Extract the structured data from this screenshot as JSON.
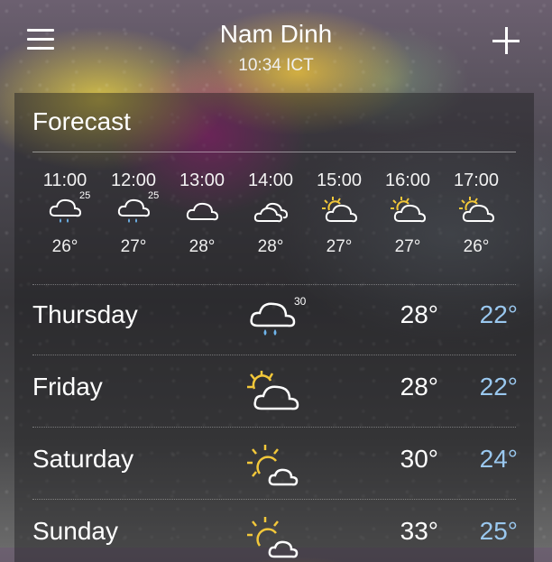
{
  "header": {
    "city": "Nam Dinh",
    "time": "10:34 ICT"
  },
  "forecast": {
    "title": "Forecast",
    "hourly": [
      {
        "time": "11:00",
        "icon": "cloud-rain-icon",
        "temp": "26°",
        "pop": "25"
      },
      {
        "time": "12:00",
        "icon": "cloud-rain-icon",
        "temp": "27°",
        "pop": "25"
      },
      {
        "time": "13:00",
        "icon": "cloud-icon",
        "temp": "28°",
        "pop": ""
      },
      {
        "time": "14:00",
        "icon": "clouds-icon",
        "temp": "28°",
        "pop": ""
      },
      {
        "time": "15:00",
        "icon": "partly-sunny-icon",
        "temp": "27°",
        "pop": ""
      },
      {
        "time": "16:00",
        "icon": "partly-sunny-icon",
        "temp": "27°",
        "pop": ""
      },
      {
        "time": "17:00",
        "icon": "partly-sunny-icon",
        "temp": "26°",
        "pop": ""
      }
    ],
    "daily": [
      {
        "day": "Thursday",
        "icon": "cloud-rain-icon",
        "pop": "30",
        "high": "28°",
        "low": "22°"
      },
      {
        "day": "Friday",
        "icon": "partly-sunny-icon",
        "pop": "",
        "high": "28°",
        "low": "22°"
      },
      {
        "day": "Saturday",
        "icon": "mostly-sunny-icon",
        "pop": "",
        "high": "30°",
        "low": "24°"
      },
      {
        "day": "Sunday",
        "icon": "mostly-sunny-icon",
        "pop": "",
        "high": "33°",
        "low": "25°"
      }
    ]
  },
  "colors": {
    "sun": "#f3c83a",
    "low_temp": "#9ac8ef",
    "rain": "#6fb5ec"
  }
}
